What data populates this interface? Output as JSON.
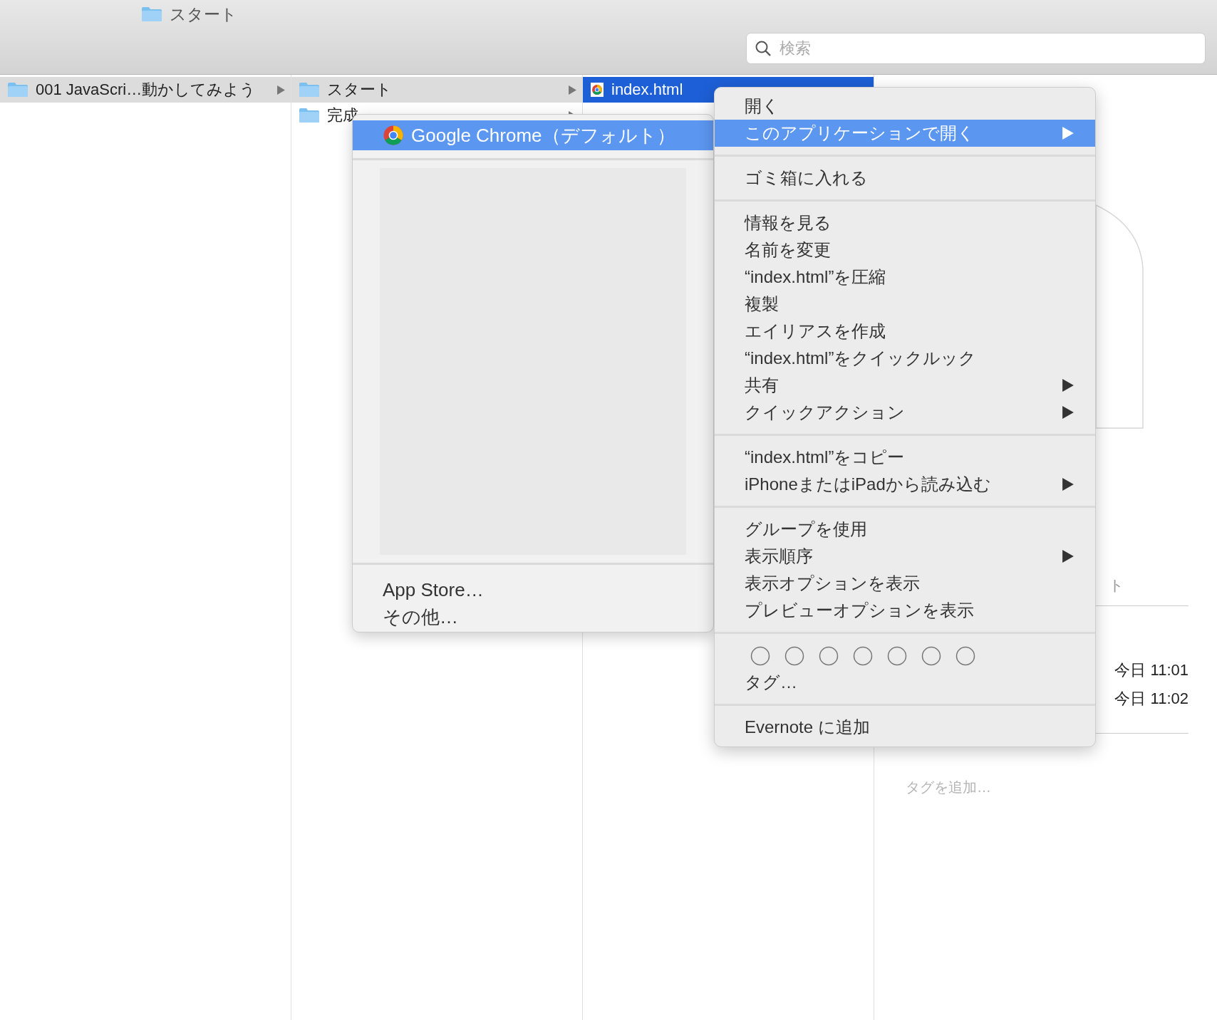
{
  "window": {
    "title": "スタート"
  },
  "search": {
    "placeholder": "検索"
  },
  "columns": [
    {
      "active": false,
      "items": [
        {
          "name": "001 JavaScri…動かしてみよう",
          "kind": "folder",
          "selected": true,
          "has_children": true
        }
      ]
    },
    {
      "active": false,
      "items": [
        {
          "name": "スタート",
          "kind": "folder",
          "selected": true,
          "has_children": true
        },
        {
          "name": "完成",
          "kind": "folder",
          "selected": false,
          "has_children": true
        }
      ]
    },
    {
      "active": true,
      "items": [
        {
          "name": "index.html",
          "kind": "chrome-file",
          "selected": true,
          "has_children": false
        }
      ]
    }
  ],
  "preview": {
    "partial_label": "ト",
    "rows": [
      {
        "value": "今日 11:01"
      },
      {
        "value": "今日 11:02"
      }
    ],
    "tags_placeholder": "タグを追加…"
  },
  "context_menu": {
    "groups": [
      {
        "kind": "items",
        "items": [
          {
            "label": "開く",
            "selected": false,
            "submenu": false
          },
          {
            "label": "このアプリケーションで開く",
            "selected": true,
            "submenu": true
          }
        ]
      },
      {
        "kind": "items",
        "items": [
          {
            "label": "ゴミ箱に入れる",
            "selected": false,
            "submenu": false
          }
        ]
      },
      {
        "kind": "items",
        "items": [
          {
            "label": "情報を見る",
            "selected": false,
            "submenu": false
          },
          {
            "label": "名前を変更",
            "selected": false,
            "submenu": false
          },
          {
            "label": "“index.html”を圧縮",
            "selected": false,
            "submenu": false
          },
          {
            "label": "複製",
            "selected": false,
            "submenu": false
          },
          {
            "label": "エイリアスを作成",
            "selected": false,
            "submenu": false
          },
          {
            "label": "“index.html”をクイックルック",
            "selected": false,
            "submenu": false
          },
          {
            "label": "共有",
            "selected": false,
            "submenu": true
          },
          {
            "label": "クイックアクション",
            "selected": false,
            "submenu": true
          }
        ]
      },
      {
        "kind": "items",
        "items": [
          {
            "label": "“index.html”をコピー",
            "selected": false,
            "submenu": false
          },
          {
            "label": "iPhoneまたはiPadから読み込む",
            "selected": false,
            "submenu": true
          }
        ]
      },
      {
        "kind": "items",
        "items": [
          {
            "label": "グループを使用",
            "selected": false,
            "submenu": false
          },
          {
            "label": "表示順序",
            "selected": false,
            "submenu": true
          },
          {
            "label": "表示オプションを表示",
            "selected": false,
            "submenu": false
          },
          {
            "label": "プレビューオプションを表示",
            "selected": false,
            "submenu": false
          }
        ]
      },
      {
        "kind": "tags",
        "label": "タグ…"
      },
      {
        "kind": "items",
        "items": [
          {
            "label": "Evernote に追加",
            "selected": false,
            "submenu": false
          }
        ]
      }
    ]
  },
  "open_with_menu": {
    "apps": [
      {
        "label": "Google Chrome（デフォルト）",
        "kind": "chrome",
        "selected": true
      }
    ],
    "others": [
      "App Store…",
      "その他…"
    ]
  }
}
